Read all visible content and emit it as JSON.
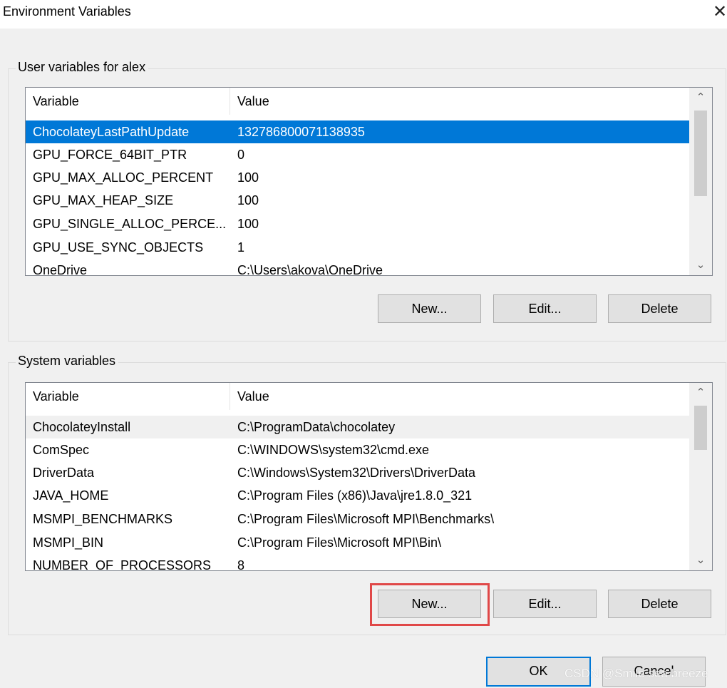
{
  "window": {
    "title": "Environment Variables",
    "close_glyph": "✕"
  },
  "user_group": {
    "label": "User variables for alex",
    "headers": {
      "variable": "Variable",
      "value": "Value"
    },
    "rows": [
      {
        "variable": "ChocolateyLastPathUpdate",
        "value": "132786800071138935",
        "selected": true
      },
      {
        "variable": "GPU_FORCE_64BIT_PTR",
        "value": "0"
      },
      {
        "variable": "GPU_MAX_ALLOC_PERCENT",
        "value": "100"
      },
      {
        "variable": "GPU_MAX_HEAP_SIZE",
        "value": "100"
      },
      {
        "variable": "GPU_SINGLE_ALLOC_PERCE...",
        "value": "100"
      },
      {
        "variable": "GPU_USE_SYNC_OBJECTS",
        "value": "1"
      },
      {
        "variable": "OneDrive",
        "value": "C:\\Users\\akova\\OneDrive"
      }
    ],
    "buttons": {
      "new": "New...",
      "edit": "Edit...",
      "delete": "Delete"
    }
  },
  "system_group": {
    "label": "System variables",
    "headers": {
      "variable": "Variable",
      "value": "Value"
    },
    "rows": [
      {
        "variable": "ChocolateyInstall",
        "value": "C:\\ProgramData\\chocolatey",
        "focused": true
      },
      {
        "variable": "ComSpec",
        "value": "C:\\WINDOWS\\system32\\cmd.exe"
      },
      {
        "variable": "DriverData",
        "value": "C:\\Windows\\System32\\Drivers\\DriverData"
      },
      {
        "variable": "JAVA_HOME",
        "value": "C:\\Program Files (x86)\\Java\\jre1.8.0_321"
      },
      {
        "variable": "MSMPI_BENCHMARKS",
        "value": "C:\\Program Files\\Microsoft MPI\\Benchmarks\\"
      },
      {
        "variable": "MSMPI_BIN",
        "value": "C:\\Program Files\\Microsoft MPI\\Bin\\"
      },
      {
        "variable": "NUMBER_OF_PROCESSORS",
        "value": "8"
      }
    ],
    "buttons": {
      "new": "New...",
      "edit": "Edit...",
      "delete": "Delete"
    }
  },
  "footer": {
    "ok": "OK",
    "cancel": "Cancel"
  },
  "scroll_glyphs": {
    "up": "⌃",
    "down": "⌄"
  },
  "watermark": "CSDN @Smile sea breeze",
  "colors": {
    "selection": "#0078d7",
    "highlight": "#e04848",
    "dialog_bg": "#f0f0f0"
  }
}
